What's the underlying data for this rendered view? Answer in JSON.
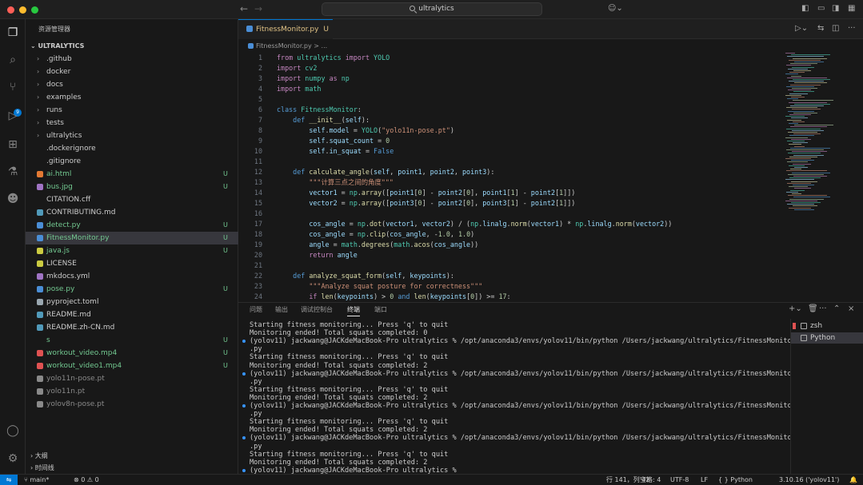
{
  "title_bar": {
    "search_text": "ultralytics",
    "colors": {
      "close": "#ff5f57",
      "minimize": "#febc2e",
      "zoom": "#28c840"
    }
  },
  "explorer": {
    "title": "资源管理器",
    "root": "ULTRALYTICS",
    "items": [
      {
        "label": ".github",
        "kind": "folder",
        "status": ""
      },
      {
        "label": "docker",
        "kind": "folder",
        "status": ""
      },
      {
        "label": "docs",
        "kind": "folder",
        "status": ""
      },
      {
        "label": "examples",
        "kind": "folder",
        "status": ""
      },
      {
        "label": "runs",
        "kind": "folder",
        "status": ""
      },
      {
        "label": "tests",
        "kind": "folder",
        "status": ""
      },
      {
        "label": "ultralytics",
        "kind": "folder",
        "status": ""
      },
      {
        "label": ".dockerignore",
        "kind": "file",
        "status": ""
      },
      {
        "label": ".gitignore",
        "kind": "file",
        "status": ""
      },
      {
        "label": "ai.html",
        "kind": "html",
        "status": "U"
      },
      {
        "label": "bus.jpg",
        "kind": "image",
        "status": "U"
      },
      {
        "label": "CITATION.cff",
        "kind": "file",
        "status": ""
      },
      {
        "label": "CONTRIBUTING.md",
        "kind": "md",
        "status": ""
      },
      {
        "label": "detect.py",
        "kind": "py",
        "status": "U"
      },
      {
        "label": "FitnessMonitor.py",
        "kind": "py",
        "status": "U"
      },
      {
        "label": "java.js",
        "kind": "js",
        "status": "U"
      },
      {
        "label": "LICENSE",
        "kind": "license",
        "status": ""
      },
      {
        "label": "mkdocs.yml",
        "kind": "yml",
        "status": ""
      },
      {
        "label": "pose.py",
        "kind": "py",
        "status": "U"
      },
      {
        "label": "pyproject.toml",
        "kind": "toml",
        "status": ""
      },
      {
        "label": "README.md",
        "kind": "md",
        "status": ""
      },
      {
        "label": "README.zh-CN.md",
        "kind": "md",
        "status": ""
      },
      {
        "label": "s",
        "kind": "file",
        "status": "U"
      },
      {
        "label": "workout_video.mp4",
        "kind": "video",
        "status": "U"
      },
      {
        "label": "workout_video1.mp4",
        "kind": "video",
        "status": "U"
      },
      {
        "label": "yolo11n-pose.pt",
        "kind": "pt",
        "status": ""
      },
      {
        "label": "yolo11n.pt",
        "kind": "pt",
        "status": ""
      },
      {
        "label": "yolov8n-pose.pt",
        "kind": "pt",
        "status": ""
      }
    ],
    "outline": "大纲",
    "timeline": "时间线"
  },
  "editor": {
    "tab": {
      "label": "FitnessMonitor.py",
      "status": "U"
    },
    "breadcrumb": "FitnessMonitor.py > ...",
    "lines": [
      [
        [
          "k",
          "from "
        ],
        [
          "c",
          "ultralytics "
        ],
        [
          "k",
          "import "
        ],
        [
          "c",
          "YOLO"
        ]
      ],
      [
        [
          "k",
          "import "
        ],
        [
          "c",
          "cv2"
        ]
      ],
      [
        [
          "k",
          "import "
        ],
        [
          "c",
          "numpy "
        ],
        [
          "k",
          "as "
        ],
        [
          "c",
          "np"
        ]
      ],
      [
        [
          "k",
          "import "
        ],
        [
          "c",
          "math"
        ]
      ],
      [],
      [
        [
          "k2",
          "class "
        ],
        [
          "c",
          "FitnessMonitor"
        ],
        [
          "t",
          ":"
        ]
      ],
      [
        [
          "t",
          "    "
        ],
        [
          "k2",
          "def "
        ],
        [
          "f",
          "__init__"
        ],
        [
          "t",
          "("
        ],
        [
          "v",
          "self"
        ],
        [
          "t",
          "):"
        ]
      ],
      [
        [
          "t",
          "        "
        ],
        [
          "v",
          "self"
        ],
        [
          "t",
          "."
        ],
        [
          "v",
          "model"
        ],
        [
          "t",
          " = "
        ],
        [
          "c",
          "YOLO"
        ],
        [
          "t",
          "("
        ],
        [
          "s",
          "\"yolo11n-pose.pt\""
        ],
        [
          "t",
          ")"
        ]
      ],
      [
        [
          "t",
          "        "
        ],
        [
          "v",
          "self"
        ],
        [
          "t",
          "."
        ],
        [
          "v",
          "squat_count"
        ],
        [
          "t",
          " = "
        ],
        [
          "n",
          "0"
        ]
      ],
      [
        [
          "t",
          "        "
        ],
        [
          "v",
          "self"
        ],
        [
          "t",
          "."
        ],
        [
          "v",
          "in_squat"
        ],
        [
          "t",
          " = "
        ],
        [
          "k2",
          "False"
        ]
      ],
      [],
      [
        [
          "t",
          "    "
        ],
        [
          "k2",
          "def "
        ],
        [
          "f",
          "calculate_angle"
        ],
        [
          "t",
          "("
        ],
        [
          "v",
          "self"
        ],
        [
          "t",
          ", "
        ],
        [
          "v",
          "point1"
        ],
        [
          "t",
          ", "
        ],
        [
          "v",
          "point2"
        ],
        [
          "t",
          ", "
        ],
        [
          "v",
          "point3"
        ],
        [
          "t",
          "):"
        ]
      ],
      [
        [
          "t",
          "        "
        ],
        [
          "s",
          "\"\"\"计算三点之间的角度\"\"\""
        ]
      ],
      [
        [
          "t",
          "        "
        ],
        [
          "v",
          "vector1"
        ],
        [
          "t",
          " = "
        ],
        [
          "c",
          "np"
        ],
        [
          "t",
          "."
        ],
        [
          "f",
          "array"
        ],
        [
          "t",
          "(["
        ],
        [
          "v",
          "point1"
        ],
        [
          "t",
          "["
        ],
        [
          "n",
          "0"
        ],
        [
          "t",
          "] - "
        ],
        [
          "v",
          "point2"
        ],
        [
          "t",
          "["
        ],
        [
          "n",
          "0"
        ],
        [
          "t",
          "], "
        ],
        [
          "v",
          "point1"
        ],
        [
          "t",
          "["
        ],
        [
          "n",
          "1"
        ],
        [
          "t",
          "] - "
        ],
        [
          "v",
          "point2"
        ],
        [
          "t",
          "["
        ],
        [
          "n",
          "1"
        ],
        [
          "t",
          "]])"
        ]
      ],
      [
        [
          "t",
          "        "
        ],
        [
          "v",
          "vector2"
        ],
        [
          "t",
          " = "
        ],
        [
          "c",
          "np"
        ],
        [
          "t",
          "."
        ],
        [
          "f",
          "array"
        ],
        [
          "t",
          "(["
        ],
        [
          "v",
          "point3"
        ],
        [
          "t",
          "["
        ],
        [
          "n",
          "0"
        ],
        [
          "t",
          "] - "
        ],
        [
          "v",
          "point2"
        ],
        [
          "t",
          "["
        ],
        [
          "n",
          "0"
        ],
        [
          "t",
          "], "
        ],
        [
          "v",
          "point3"
        ],
        [
          "t",
          "["
        ],
        [
          "n",
          "1"
        ],
        [
          "t",
          "] - "
        ],
        [
          "v",
          "point2"
        ],
        [
          "t",
          "["
        ],
        [
          "n",
          "1"
        ],
        [
          "t",
          "]])"
        ]
      ],
      [],
      [
        [
          "t",
          "        "
        ],
        [
          "v",
          "cos_angle"
        ],
        [
          "t",
          " = "
        ],
        [
          "c",
          "np"
        ],
        [
          "t",
          "."
        ],
        [
          "f",
          "dot"
        ],
        [
          "t",
          "("
        ],
        [
          "v",
          "vector1"
        ],
        [
          "t",
          ", "
        ],
        [
          "v",
          "vector2"
        ],
        [
          "t",
          ") / ("
        ],
        [
          "c",
          "np"
        ],
        [
          "t",
          "."
        ],
        [
          "v",
          "linalg"
        ],
        [
          "t",
          "."
        ],
        [
          "f",
          "norm"
        ],
        [
          "t",
          "("
        ],
        [
          "v",
          "vector1"
        ],
        [
          "t",
          ") * "
        ],
        [
          "c",
          "np"
        ],
        [
          "t",
          "."
        ],
        [
          "v",
          "linalg"
        ],
        [
          "t",
          "."
        ],
        [
          "f",
          "norm"
        ],
        [
          "t",
          "("
        ],
        [
          "v",
          "vector2"
        ],
        [
          "t",
          "))"
        ]
      ],
      [
        [
          "t",
          "        "
        ],
        [
          "v",
          "cos_angle"
        ],
        [
          "t",
          " = "
        ],
        [
          "c",
          "np"
        ],
        [
          "t",
          "."
        ],
        [
          "f",
          "clip"
        ],
        [
          "t",
          "("
        ],
        [
          "v",
          "cos_angle"
        ],
        [
          "t",
          ", -"
        ],
        [
          "n",
          "1.0"
        ],
        [
          "t",
          ", "
        ],
        [
          "n",
          "1.0"
        ],
        [
          "t",
          ")"
        ]
      ],
      [
        [
          "t",
          "        "
        ],
        [
          "v",
          "angle"
        ],
        [
          "t",
          " = "
        ],
        [
          "c",
          "math"
        ],
        [
          "t",
          "."
        ],
        [
          "f",
          "degrees"
        ],
        [
          "t",
          "("
        ],
        [
          "c",
          "math"
        ],
        [
          "t",
          "."
        ],
        [
          "f",
          "acos"
        ],
        [
          "t",
          "("
        ],
        [
          "v",
          "cos_angle"
        ],
        [
          "t",
          "))"
        ]
      ],
      [
        [
          "t",
          "        "
        ],
        [
          "k",
          "return "
        ],
        [
          "v",
          "angle"
        ]
      ],
      [],
      [
        [
          "t",
          "    "
        ],
        [
          "k2",
          "def "
        ],
        [
          "f",
          "analyze_squat_form"
        ],
        [
          "t",
          "("
        ],
        [
          "v",
          "self"
        ],
        [
          "t",
          ", "
        ],
        [
          "v",
          "keypoints"
        ],
        [
          "t",
          "):"
        ]
      ],
      [
        [
          "t",
          "        "
        ],
        [
          "s",
          "\"\"\"Analyze squat posture for correctness\"\"\""
        ]
      ],
      [
        [
          "t",
          "        "
        ],
        [
          "k",
          "if "
        ],
        [
          "f",
          "len"
        ],
        [
          "t",
          "("
        ],
        [
          "v",
          "keypoints"
        ],
        [
          "t",
          ") > "
        ],
        [
          "n",
          "0"
        ],
        [
          "t",
          " "
        ],
        [
          "k2",
          "and "
        ],
        [
          "f",
          "len"
        ],
        [
          "t",
          "("
        ],
        [
          "v",
          "keypoints"
        ],
        [
          "t",
          "["
        ],
        [
          "n",
          "0"
        ],
        [
          "t",
          "]) >= "
        ],
        [
          "n",
          "17"
        ],
        [
          "t",
          ":"
        ]
      ]
    ]
  },
  "panel": {
    "tabs": [
      "问题",
      "输出",
      "调试控制台",
      "终端",
      "端口"
    ],
    "active_tab": "终端",
    "terminal_lines": [
      {
        "dot": false,
        "text": "Starting fitness monitoring... Press 'q' to quit"
      },
      {
        "dot": false,
        "text": "Monitoring ended! Total squats completed: 0"
      },
      {
        "dot": true,
        "text": "(yolov11) jackwang@JACKdeMacBook-Pro ultralytics % /opt/anaconda3/envs/yolov11/bin/python /Users/jackwang/ultralytics/FitnessMonitor"
      },
      {
        "dot": false,
        "text": ".py"
      },
      {
        "dot": false,
        "text": "Starting fitness monitoring... Press 'q' to quit"
      },
      {
        "dot": false,
        "text": "Monitoring ended! Total squats completed: 2"
      },
      {
        "dot": true,
        "text": "(yolov11) jackwang@JACKdeMacBook-Pro ultralytics % /opt/anaconda3/envs/yolov11/bin/python /Users/jackwang/ultralytics/FitnessMonitor"
      },
      {
        "dot": false,
        "text": ".py"
      },
      {
        "dot": false,
        "text": "Starting fitness monitoring... Press 'q' to quit"
      },
      {
        "dot": false,
        "text": "Monitoring ended! Total squats completed: 2"
      },
      {
        "dot": true,
        "text": "(yolov11) jackwang@JACKdeMacBook-Pro ultralytics % /opt/anaconda3/envs/yolov11/bin/python /Users/jackwang/ultralytics/FitnessMonitor"
      },
      {
        "dot": false,
        "text": ".py"
      },
      {
        "dot": false,
        "text": "Starting fitness monitoring... Press 'q' to quit"
      },
      {
        "dot": false,
        "text": "Monitoring ended! Total squats completed: 2"
      },
      {
        "dot": true,
        "text": "(yolov11) jackwang@JACKdeMacBook-Pro ultralytics % /opt/anaconda3/envs/yolov11/bin/python /Users/jackwang/ultralytics/FitnessMonitor"
      },
      {
        "dot": false,
        "text": ".py"
      },
      {
        "dot": false,
        "text": "Starting fitness monitoring... Press 'q' to quit"
      },
      {
        "dot": false,
        "text": "Monitoring ended! Total squats completed: 2"
      },
      {
        "dot": true,
        "text": "(yolov11) jackwang@JACKdeMacBook-Pro ultralytics % "
      }
    ],
    "terminals": [
      {
        "label": "zsh",
        "selected": false
      },
      {
        "label": "Python",
        "selected": true
      }
    ]
  },
  "status_bar": {
    "branch": "main*",
    "errors": "0",
    "warnings": "0",
    "cursor": "行 141，列 42",
    "indent": "空格: 4",
    "encoding": "UTF-8",
    "eol": "LF",
    "language": "Python",
    "interpreter": "3.10.16 ('yolov11')"
  },
  "theme": {
    "accent": "#0078d4",
    "untracked": "#73c991",
    "folder": "#cccccc"
  }
}
